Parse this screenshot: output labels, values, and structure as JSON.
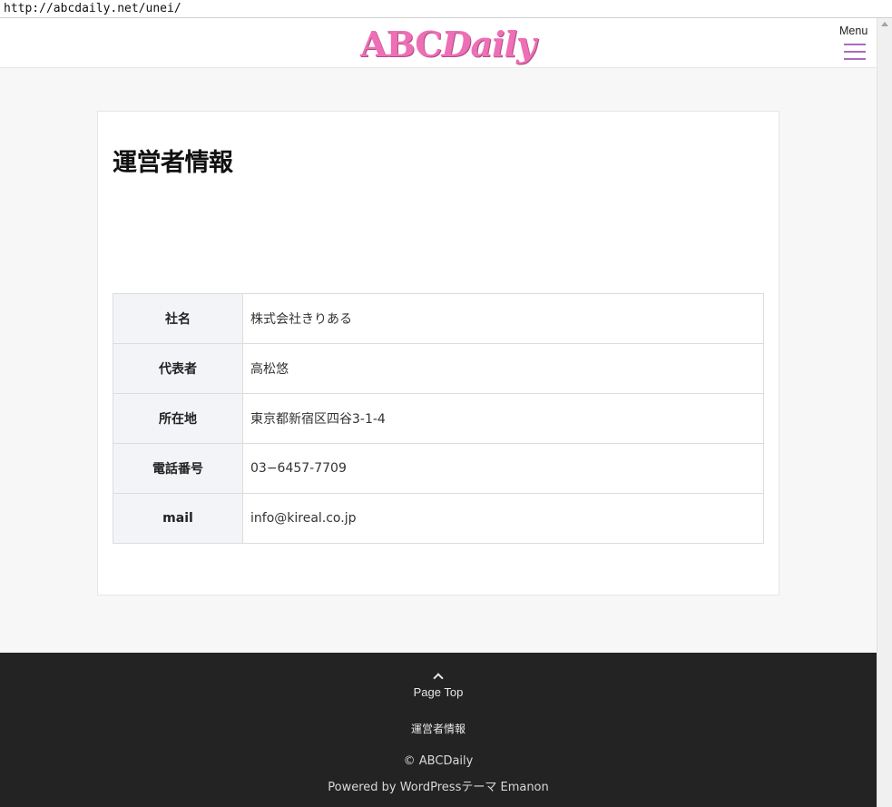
{
  "address_bar": {
    "url": "http://abcdaily.net/unei/"
  },
  "header": {
    "logo": {
      "part1": "ABC",
      "part2": "Daily"
    },
    "menu_label": "Menu",
    "accent_color": "#ee6fb6",
    "menu_icon_color": "#a86bbf"
  },
  "main": {
    "title": "運営者情報",
    "rows": [
      {
        "label": "社名",
        "value": "株式会社きりある"
      },
      {
        "label": "代表者",
        "value": "高松悠"
      },
      {
        "label": "所在地",
        "value": "東京都新宿区四谷3-1-4"
      },
      {
        "label": "電話番号",
        "value": "03−6457-7709"
      },
      {
        "label": "mail",
        "value": "info@kireal.co.jp"
      }
    ]
  },
  "footer": {
    "pagetop_label": "Page Top",
    "pagetop_icon": "chevron-up-icon",
    "nav_link": "運営者情報",
    "copyright": "© ABCDaily",
    "powered_by": "Powered by WordPressテーマ Emanon",
    "background_color": "#232323"
  }
}
